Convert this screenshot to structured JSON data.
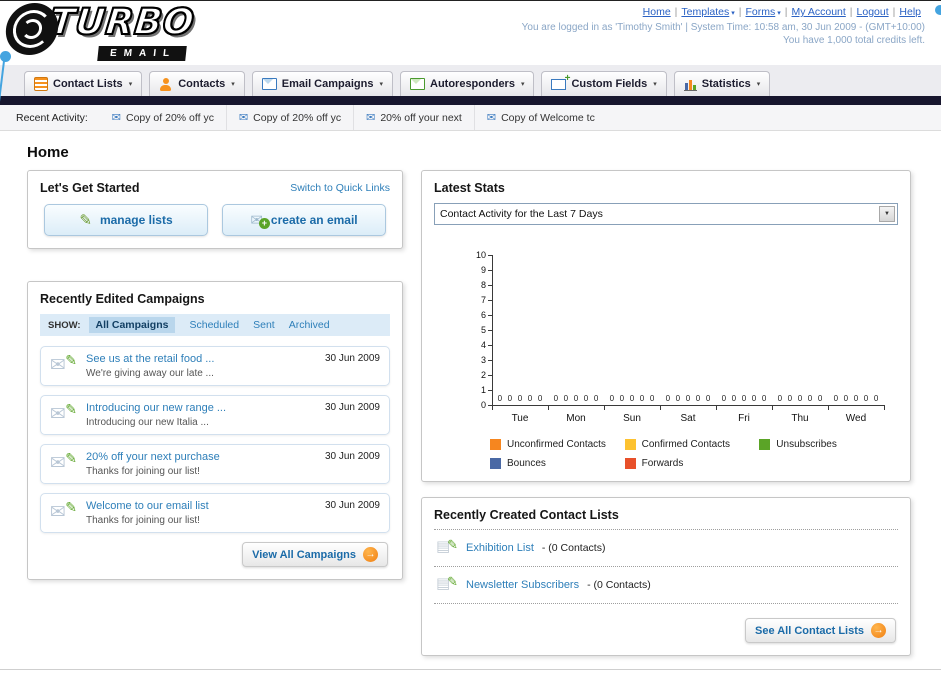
{
  "page_title": "Home",
  "colors": {
    "link_blue": "#2e7fb9",
    "accent_orange": "#f6861f",
    "nav_dark": "#17162e"
  },
  "header": {
    "logo_title": "TURBO",
    "logo_subtitle": "EMAIL",
    "nav_links": [
      {
        "label": "Home",
        "dropdown": false
      },
      {
        "label": "Templates",
        "dropdown": true
      },
      {
        "label": "Forms",
        "dropdown": true
      },
      {
        "label": "My Account",
        "dropdown": false
      },
      {
        "label": "Logout",
        "dropdown": false
      },
      {
        "label": "Help",
        "dropdown": false
      }
    ],
    "login_info": "You are logged in as 'Timothy Smith' | System Time: 10:58 am, 30 Jun 2009 - (GMT+10:00)",
    "credits_info": "You have 1,000 total credits left."
  },
  "main_nav": {
    "items": [
      {
        "label": "Contact Lists",
        "icon": "contact-lists-icon"
      },
      {
        "label": "Contacts",
        "icon": "contacts-icon"
      },
      {
        "label": "Email Campaigns",
        "icon": "email-campaigns-icon"
      },
      {
        "label": "Autoresponders",
        "icon": "autoresponders-icon"
      },
      {
        "label": "Custom Fields",
        "icon": "custom-fields-icon"
      },
      {
        "label": "Statistics",
        "icon": "statistics-icon"
      }
    ]
  },
  "recent_activity": {
    "label": "Recent Activity:",
    "items": [
      "Copy of 20% off yc",
      "Copy of 20% off yc",
      "20% off your next",
      "Copy of Welcome tc"
    ]
  },
  "get_started": {
    "title": "Let's Get Started",
    "switch_link": "Switch to Quick Links",
    "manage_lists_label": "manage lists",
    "create_email_label": "create an email"
  },
  "campaigns": {
    "title": "Recently Edited Campaigns",
    "show_label": "SHOW:",
    "tabs": [
      "All Campaigns",
      "Scheduled",
      "Sent",
      "Archived"
    ],
    "selected_tab": "All Campaigns",
    "items": [
      {
        "title": "See us at the retail food ...",
        "subtitle": "We're giving away our late ...",
        "date": "30 Jun 2009"
      },
      {
        "title": "Introducing our new range ...",
        "subtitle": "Introducing our new Italia ...",
        "date": "30 Jun 2009"
      },
      {
        "title": "20% off your next purchase",
        "subtitle": "Thanks for joining our list!",
        "date": "30 Jun 2009"
      },
      {
        "title": "Welcome to our email list",
        "subtitle": "Thanks for joining our list!",
        "date": "30 Jun 2009"
      }
    ],
    "view_all_label": "View All Campaigns"
  },
  "latest_stats": {
    "title": "Latest Stats",
    "period_selector": "Contact Activity for the Last 7 Days",
    "chart_data": {
      "type": "bar",
      "title": "Contact Activity for the Last 7 Days",
      "categories": [
        "Tue",
        "Mon",
        "Sun",
        "Sat",
        "Fri",
        "Thu",
        "Wed"
      ],
      "series": [
        {
          "name": "Unconfirmed Contacts",
          "color": "#f6861f",
          "values": [
            0,
            0,
            0,
            0,
            0,
            0,
            0
          ]
        },
        {
          "name": "Confirmed Contacts",
          "color": "#fdc230",
          "values": [
            0,
            0,
            0,
            0,
            0,
            0,
            0
          ]
        },
        {
          "name": "Unsubscribes",
          "color": "#5ba427",
          "values": [
            0,
            0,
            0,
            0,
            0,
            0,
            0
          ]
        },
        {
          "name": "Bounces",
          "color": "#4a69a5",
          "values": [
            0,
            0,
            0,
            0,
            0,
            0,
            0
          ]
        },
        {
          "name": "Forwards",
          "color": "#e8502a",
          "values": [
            0,
            0,
            0,
            0,
            0,
            0,
            0
          ]
        }
      ],
      "xlabel": "",
      "ylabel": "",
      "ylim": [
        0,
        10
      ],
      "yticks": [
        0,
        1,
        2,
        3,
        4,
        5,
        6,
        7,
        8,
        9,
        10
      ],
      "value_labels": true,
      "grid": false,
      "legend_position": "bottom"
    }
  },
  "contact_lists": {
    "title": "Recently Created Contact Lists",
    "items": [
      {
        "name": "Exhibition List",
        "detail": "- (0 Contacts)"
      },
      {
        "name": "Newsletter Subscribers",
        "detail": "- (0 Contacts)"
      }
    ],
    "see_all_label": "See All Contact Lists"
  }
}
